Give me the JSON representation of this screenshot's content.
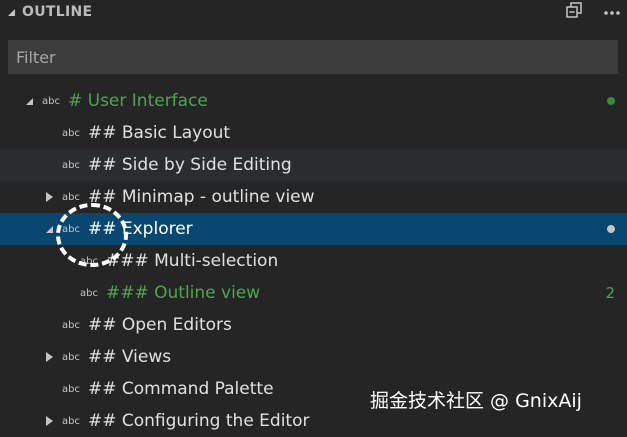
{
  "header": {
    "title": "OUTLINE",
    "collapse_icon": "collapse-all-icon",
    "more_icon": "ellipsis-icon"
  },
  "filter": {
    "placeholder": "Filter",
    "value": ""
  },
  "tree": {
    "items": [
      {
        "symbol": "abc",
        "label": "# User Interface",
        "color": "#4ea64e",
        "twisty": "expanded",
        "decoration": "dot",
        "decoration_color": "#388a34"
      },
      {
        "symbol": "abc",
        "label": "## Basic Layout",
        "twisty": "none"
      },
      {
        "symbol": "abc",
        "label": "## Side by Side Editing",
        "twisty": "none"
      },
      {
        "symbol": "abc",
        "label": "## Minimap - outline view",
        "twisty": "collapsed"
      },
      {
        "symbol": "abc",
        "label": "## Explorer",
        "twisty": "expanded",
        "selected": true,
        "decoration": "dot",
        "decoration_color": "#c5c5c5"
      },
      {
        "symbol": "abc",
        "label": "### Multi-selection",
        "twisty": "none"
      },
      {
        "symbol": "abc",
        "label": "### Outline view",
        "color": "#4ea64e",
        "twisty": "none",
        "decoration": "text",
        "decoration_text": "2",
        "decoration_color": "#4ea64e"
      },
      {
        "symbol": "abc",
        "label": "## Open Editors",
        "twisty": "none"
      },
      {
        "symbol": "abc",
        "label": "## Views",
        "twisty": "collapsed"
      },
      {
        "symbol": "abc",
        "label": "## Command Palette",
        "twisty": "none"
      },
      {
        "symbol": "abc",
        "label": "## Configuring the Editor",
        "twisty": "collapsed"
      }
    ]
  },
  "watermark": "掘金技术社区 @ GnixAij",
  "colors": {
    "background": "#252526",
    "selection": "#094771",
    "input": "#3c3c3c",
    "green": "#4ea64e"
  }
}
